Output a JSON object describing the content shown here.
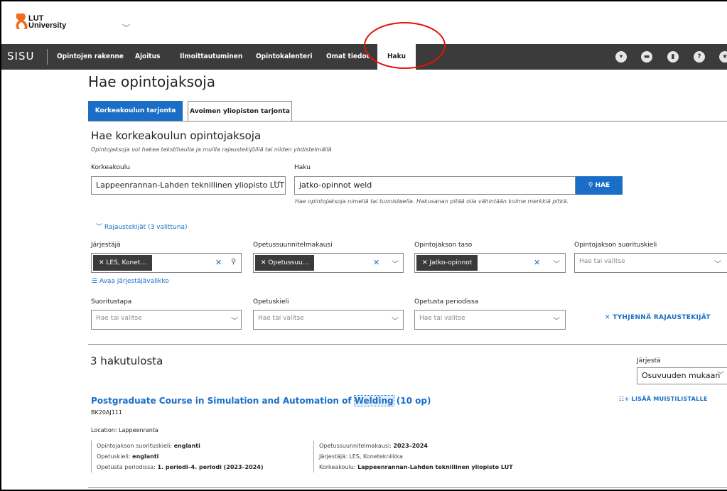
{
  "brand": {
    "logo_line1": "LUT",
    "logo_line2": "University"
  },
  "nav": {
    "app_name": "SISU",
    "items": [
      "Opintojen rakenne",
      "Ajoitus",
      "Ilmoittautuminen",
      "Opintokalenteri",
      "Omat tiedot",
      "Haku"
    ],
    "active": "Haku"
  },
  "page": {
    "title": "Hae opintojaksoja",
    "tabs": [
      "Korkeakoulun tarjonta",
      "Avoimen yliopiston tarjonta"
    ]
  },
  "search": {
    "section_title": "Hae korkeakoulun opintojaksoja",
    "section_subtitle": "Opintojaksoja voi hakea tekstihaulla ja muilla rajaustekijöillä tai niiden yhdistelmällä",
    "university_label": "Korkeakoulu",
    "university_value": "Lappeenrannan-Lahden teknillinen yliopisto LUT",
    "query_label": "Haku",
    "query_value": "jatko-opinnot weld",
    "button_label": "HAE",
    "help_text": "Hae opintojaksoja nimellä tai tunnisteella. Hakusanan pitää olla vähintään kolme merkkiä pitkä."
  },
  "filters": {
    "toggle_label": "Rajaustekijät (3 valittuna)",
    "organizer_label": "Järjestäjä",
    "organizer_chip": "LES, Konet...",
    "curriculum_label": "Opetussuunnitelmakausi",
    "curriculum_chip": "Opetussuu...",
    "level_label": "Opintojakson taso",
    "level_chip": "Jatko-opinnot",
    "language_label": "Opintojakson suorituskieli",
    "placeholder": "Hae tai valitse",
    "org_menu_link": "Avaa järjestäjävalikko",
    "method_label": "Suoritustapa",
    "teaching_lang_label": "Opetuskieli",
    "period_label": "Opetusta periodissa",
    "clear_label": "TYHJENNÄ RAJAUSTEKIJÄT"
  },
  "results": {
    "count_title": "3 hakutulosta",
    "sort_label": "Järjestä",
    "sort_value": "Osuvuuden mukaan",
    "items": [
      {
        "title_before": "Postgraduate Course in Simulation and Automation of ",
        "title_highlight": "Welding",
        "title_after": " (10 op)",
        "code": "BK20AJ111",
        "add_label": "LISÄÄ MUISTILISTALLE",
        "location": "Location: Lappeenranta",
        "left_labels": [
          "Opintojakson suorituskieli:",
          "Opetuskieli:",
          "Opetusta periodissa:"
        ],
        "left_values": [
          "englanti",
          "englanti",
          "1. periodi–4. periodi (2023–2024)"
        ],
        "right_labels": [
          "Opetussuunnitelmakausi:",
          "Järjestäjä:",
          "Korkeakoulu:"
        ],
        "right_values": [
          "2023–2024",
          "LES, Konetekniikka",
          "Lappeenrannan-Lahden teknillinen yliopisto LUT"
        ]
      }
    ]
  },
  "colors": {
    "accent": "#1a6ec7",
    "nav_bg": "#3b3b3b",
    "annotation": "#e3120b",
    "logo_orange": "#f26b21"
  },
  "icons": [
    "chevron-down-icon",
    "cart-icon",
    "message-icon",
    "notes-icon",
    "help-icon",
    "star-icon",
    "search-icon",
    "close-icon",
    "list-icon"
  ]
}
